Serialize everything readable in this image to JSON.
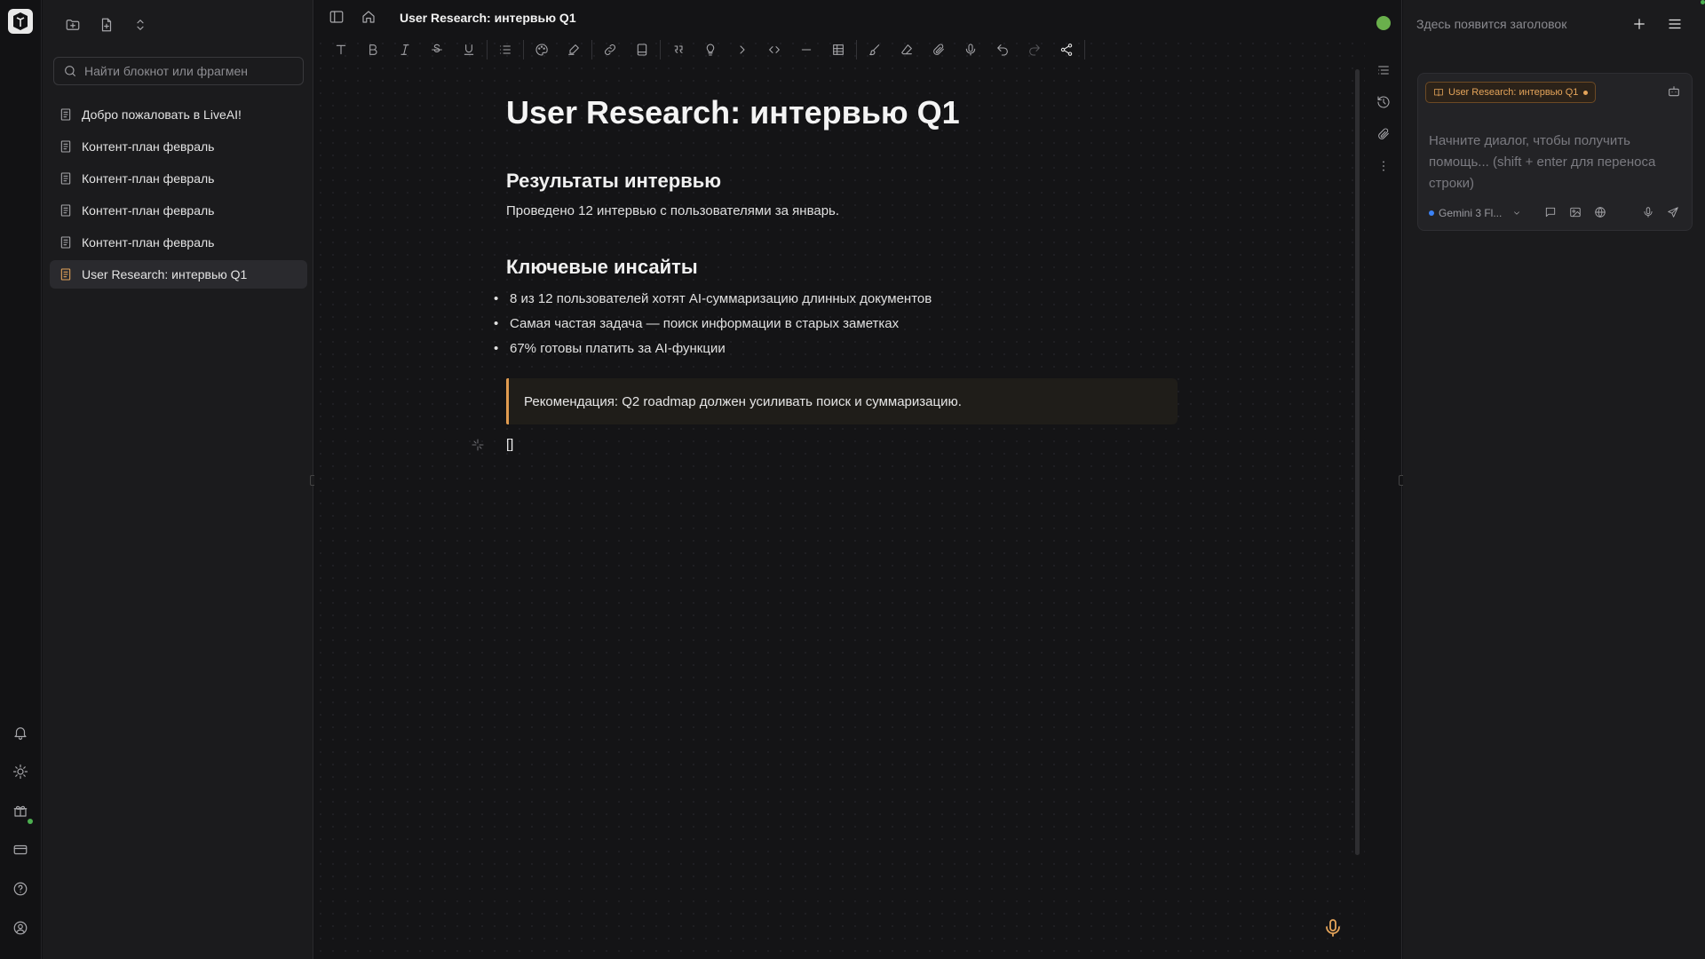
{
  "editor": {
    "document_title": "User Research: интервью Q1",
    "heading": "User Research: интервью Q1",
    "section1_title": "Результаты интервью",
    "section1_text": "Проведено 12 интервью с пользователями за январь.",
    "section2_title": "Ключевые инсайты",
    "bullets": [
      "8 из 12 пользователей хотят AI-суммаризацию длинных документов",
      "Самая частая задача — поиск информации в старых заметках",
      "67% готовы платить за AI-функции"
    ],
    "callout": "Рекомендация: Q2 roadmap должен усиливать поиск и суммаризацию.",
    "cursor_block": "[]"
  },
  "sidebar": {
    "search_placeholder": "Найти блокнот или фрагмен",
    "notes": [
      {
        "label": "Добро пожаловать в LiveAI!",
        "active": false
      },
      {
        "label": "Контент-план февраль",
        "active": false
      },
      {
        "label": "Контент-план февраль",
        "active": false
      },
      {
        "label": "Контент-план февраль",
        "active": false
      },
      {
        "label": "Контент-план февраль",
        "active": false
      },
      {
        "label": "User Research: интервью Q1",
        "active": true
      }
    ]
  },
  "assistant": {
    "header_placeholder": "Здесь появится заголовок",
    "context_chip": "User Research: интервью Q1",
    "prompt_placeholder": "Начните диалог, чтобы получить помощь... (shift + enter для переноса строки)",
    "model_label": "Gemini 3 Fl...",
    "colors": {
      "accent": "#e4a45a",
      "status": "#6ab04c",
      "model_dot": "#3b82f6"
    }
  }
}
